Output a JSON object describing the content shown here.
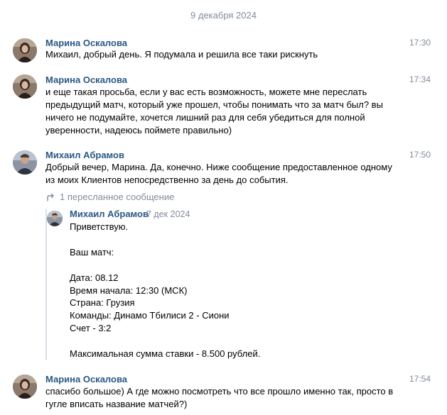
{
  "date_separator": "9 декабря 2024",
  "messages": [
    {
      "author": "Марина Оскалова",
      "time": "17:30",
      "lines": [
        "Михаил, добрый день. Я подумала и решила все таки рискнуть"
      ]
    },
    {
      "author": "Марина Оскалова",
      "time": "17:34",
      "lines": [
        "и еще такая просьба, если у вас есть возможность, можете мне переслать",
        "предыдущий матч, который уже прошел, чтобы понимать что за матч был? вы",
        "ничего не подумайте, хочется лишний раз для себя убедиться для полной",
        "уверенности, надеюсь поймете правильно)"
      ]
    },
    {
      "author": "Михаил Абрамов",
      "time": "17:50",
      "lines": [
        "Добрый вечер, Марина. Да, конечно.  Ниже сообщение предоставленное одному",
        "из моих Клиентов непосредственно за день до события."
      ],
      "forwarded_label": "1 пересланное сообщение",
      "forwarded": {
        "author": "Михаил Абрамов",
        "date": "7 дек 2024",
        "lines": [
          "Приветствую.",
          "",
          "Ваш матч:",
          "",
          "Дата: 08.12",
          "Время начала: 12:30 (МСК)",
          "Страна: Грузия",
          "Команды: Динамо Тбилиси 2 - Сиони",
          "Счет - 3:2",
          "",
          "Максимальная сумма ставки - 8.500 рублей."
        ]
      }
    },
    {
      "author": "Марина Оскалова",
      "time": "17:54",
      "lines": [
        "спасибо большое) А где можно посмотреть что все прошло именно так, просто в",
        "гугле вписать название матчей?)"
      ]
    }
  ],
  "colors": {
    "author_link": "#2a5885",
    "meta_gray": "#818c99",
    "forward_bar": "#dce1e6"
  },
  "icons": {
    "forward": "forward-arrow-icon"
  }
}
